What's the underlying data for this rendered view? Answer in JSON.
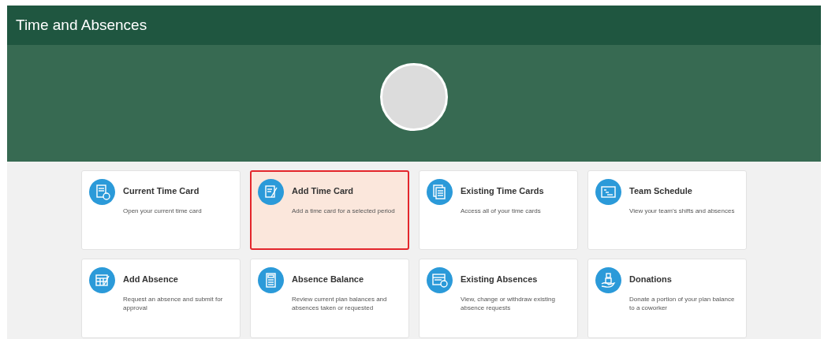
{
  "header": {
    "title": "Time and Absences"
  },
  "tiles": [
    {
      "title": "Current Time Card",
      "description": "Open your current time card",
      "selected": false
    },
    {
      "title": "Add Time Card",
      "description": "Add a time card for a selected period",
      "selected": true
    },
    {
      "title": "Existing Time Cards",
      "description": "Access all of your time cards",
      "selected": false
    },
    {
      "title": "Team Schedule",
      "description": "View your team's shifts and absences",
      "selected": false
    },
    {
      "title": "Add Absence",
      "description": "Request an absence and submit for approval",
      "selected": false
    },
    {
      "title": "Absence Balance",
      "description": "Review current plan balances and absences taken or requested",
      "selected": false
    },
    {
      "title": "Existing Absences",
      "description": "View, change or withdraw existing absence requests",
      "selected": false
    },
    {
      "title": "Donations",
      "description": "Donate a portion of your plan balance to a coworker",
      "selected": false
    }
  ]
}
